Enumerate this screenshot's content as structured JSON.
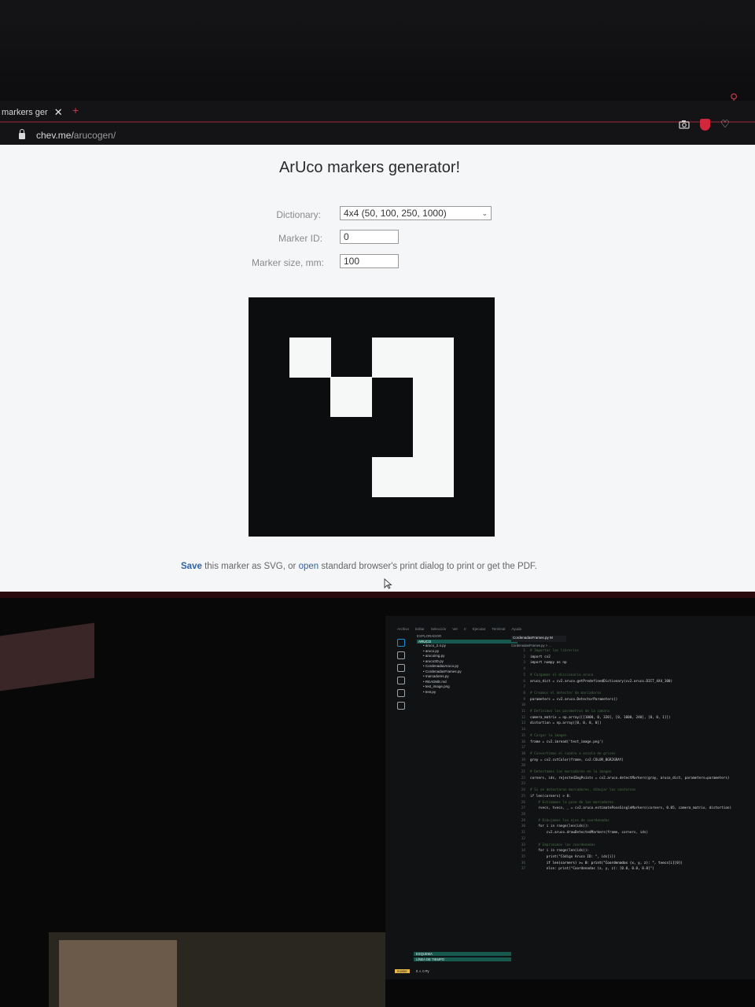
{
  "browser": {
    "tab_title": "markers ger",
    "tab_close": "✕",
    "new_tab": "+",
    "url_host": "chev.me/",
    "url_path": "arucogen/",
    "toolbar_icons": [
      "camera-icon",
      "shield-icon",
      "heart-icon"
    ]
  },
  "page": {
    "title": "ArUco markers generator!",
    "dictionary_label": "Dictionary:",
    "dictionary_value": "4x4 (50, 100, 250, 1000)",
    "marker_id_label": "Marker ID:",
    "marker_id_value": "0",
    "marker_size_label": "Marker size, mm:",
    "marker_size_value": "100",
    "save_link": "Save",
    "save_mid": "this marker as SVG, or",
    "open_link": "open",
    "save_tail": "standard browser's print dialog to print or get the PDF."
  },
  "marker": {
    "grid": 6,
    "white_cells": [
      [
        1,
        1
      ],
      [
        2,
        2
      ],
      [
        1,
        3
      ],
      [
        1,
        4
      ],
      [
        2,
        4
      ],
      [
        3,
        4
      ],
      [
        4,
        3
      ],
      [
        4,
        4
      ]
    ]
  },
  "editor": {
    "menu": [
      "Archivo",
      "Editar",
      "Selección",
      "Ver",
      "Ir",
      "Ejecutar",
      "Terminal",
      "Ayuda"
    ],
    "explorer_title": "EXPLORADOR",
    "folder": "ARUCO",
    "files": [
      "aruco_2.4.py",
      "aruco.py",
      "arucoimg.py",
      "aruco3D.py",
      "CordenadasAruco.py",
      "CordenadasFrames.py",
      "marcadores.py",
      "README.md",
      "test_image.png",
      "test.py"
    ],
    "tab": "CordenadasFrames.py M",
    "breadcrumb": "CordenadasFrames.py > ...",
    "code": [
      {
        "n": "1",
        "t": "# Importar las librerias",
        "c": "cm"
      },
      {
        "n": "2",
        "t": "import cv2",
        "c": "kw"
      },
      {
        "n": "3",
        "t": "import numpy as np",
        "c": "kw"
      },
      {
        "n": "4",
        "t": "",
        "c": "kw"
      },
      {
        "n": "5",
        "t": "# Cargamos el diccionario aruco",
        "c": "cm"
      },
      {
        "n": "6",
        "t": "aruco_dict = cv2.aruco.getPredefinedDictionary(cv2.aruco.DICT_4X4_100)",
        "c": "kw"
      },
      {
        "n": "7",
        "t": "",
        "c": "kw"
      },
      {
        "n": "8",
        "t": "# Creamos el detector de marcadores",
        "c": "cm"
      },
      {
        "n": "9",
        "t": "parameters = cv2.aruco.DetectorParameters()",
        "c": "kw"
      },
      {
        "n": "10",
        "t": "",
        "c": "kw"
      },
      {
        "n": "11",
        "t": "# Definimos los parametros de la camara",
        "c": "cm"
      },
      {
        "n": "12",
        "t": "camera_matrix = np.array([[1000, 0, 320], [0, 1000, 240], [0, 0, 1]])",
        "c": "kw"
      },
      {
        "n": "13",
        "t": "distortion = np.array([0, 0, 0, 0])",
        "c": "kw"
      },
      {
        "n": "14",
        "t": "",
        "c": "kw"
      },
      {
        "n": "15",
        "t": "# Cargar la imagen",
        "c": "cm"
      },
      {
        "n": "16",
        "t": "frame = cv2.imread('test_image.png')",
        "c": "kw"
      },
      {
        "n": "17",
        "t": "",
        "c": "kw"
      },
      {
        "n": "18",
        "t": "# Convertimos el cuadro a escala de grises",
        "c": "cm"
      },
      {
        "n": "19",
        "t": "gray = cv2.cvtColor(frame, cv2.COLOR_BGR2GRAY)",
        "c": "kw"
      },
      {
        "n": "20",
        "t": "",
        "c": "kw"
      },
      {
        "n": "21",
        "t": "# Detectamos los marcadores en la imagen",
        "c": "cm"
      },
      {
        "n": "22",
        "t": "corners, ids, rejectedImgPoints = cv2.aruco.detectMarkers(gray, aruco_dict, parameters=parameters)",
        "c": "kw"
      },
      {
        "n": "23",
        "t": "",
        "c": "kw"
      },
      {
        "n": "24",
        "t": "# Si se detectaron marcadores, dibujar los contornos",
        "c": "cm"
      },
      {
        "n": "25",
        "t": "if len(corners) > 0:",
        "c": "kw"
      },
      {
        "n": "26",
        "t": "    # Estimamos la pose de los marcadores",
        "c": "cm"
      },
      {
        "n": "27",
        "t": "    rvecs, tvecs, _ = cv2.aruco.estimatePoseSingleMarkers(corners, 0.05, camera_matrix, distortion)",
        "c": "kw"
      },
      {
        "n": "28",
        "t": "",
        "c": "kw"
      },
      {
        "n": "29",
        "t": "    # Dibujamos los ejes de coordenadas",
        "c": "cm"
      },
      {
        "n": "30",
        "t": "    for i in range(len(ids)):",
        "c": "kw"
      },
      {
        "n": "31",
        "t": "        cv2.aruco.drawDetectedMarkers(frame, corners, ids)",
        "c": "kw"
      },
      {
        "n": "32",
        "t": "",
        "c": "kw"
      },
      {
        "n": "33",
        "t": "    # Imprimimos las coordenadas",
        "c": "cm"
      },
      {
        "n": "34",
        "t": "    for i in range(len(ids)):",
        "c": "kw"
      },
      {
        "n": "35",
        "t": "        print(\"Código Aruco ID: \", ids[i])",
        "c": "kw"
      },
      {
        "n": "36",
        "t": "        if len(corners) >= 0: print(\"Coordenadas (x, y, z): \", tvecs[i][0])",
        "c": "hl"
      },
      {
        "n": "37",
        "t": "        else: print(\"Coordenadas (x, y, z): [0.0, 0.0, 0.0]\")",
        "c": "kw"
      }
    ],
    "outline": [
      "ESQUEMA",
      "LÍNEA DE TIEMPO"
    ],
    "status_mode": "master",
    "status_info": "0 ⚠ 0  Py"
  },
  "colors": {
    "page_bg": "#f4f6f7",
    "link": "#2f62a6",
    "marker_black": "#0c0d0f",
    "vsc_accent": "#16594f"
  }
}
